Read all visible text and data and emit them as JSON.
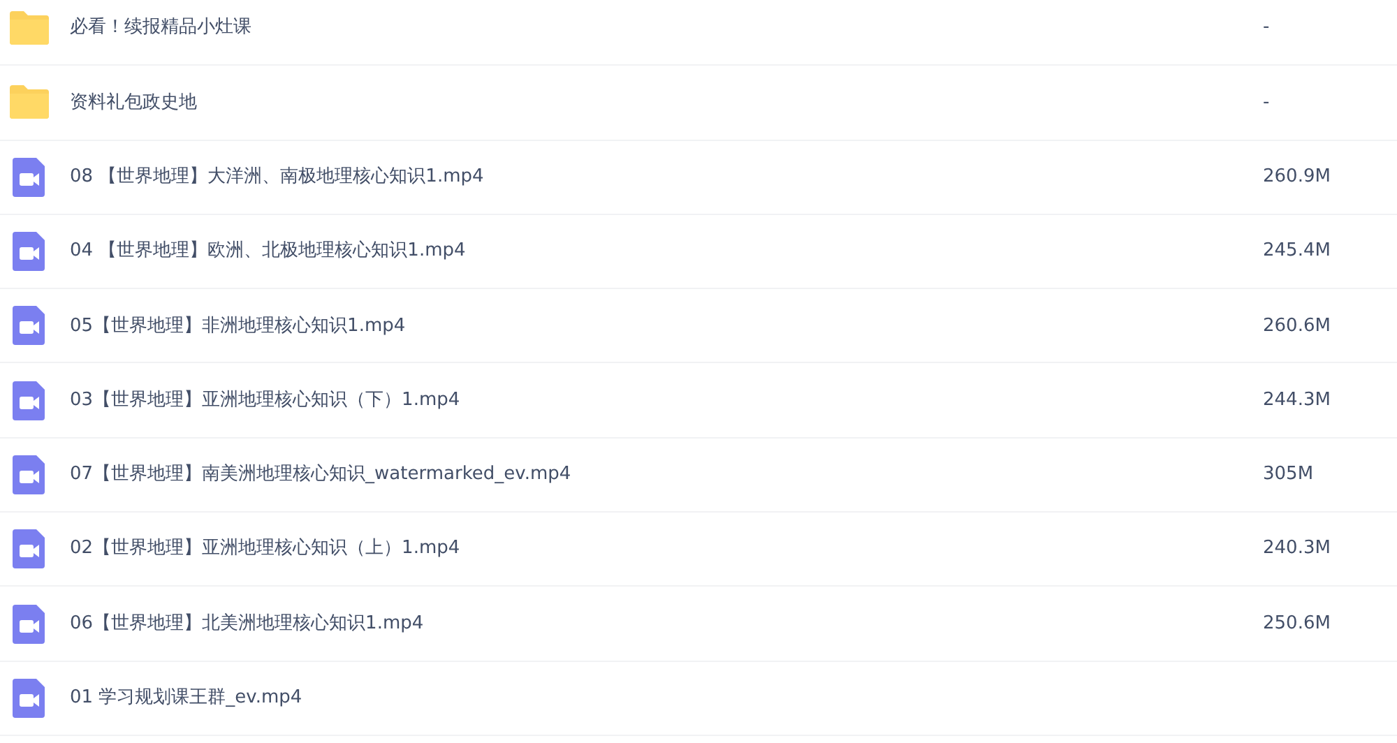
{
  "files": [
    {
      "kind": "folder",
      "name": "必看！续报精品小灶课",
      "size": "-"
    },
    {
      "kind": "folder",
      "name": "资料礼包政史地",
      "size": "-"
    },
    {
      "kind": "video",
      "name": "08 【世界地理】大洋洲、南极地理核心知识1.mp4",
      "size": "260.9M"
    },
    {
      "kind": "video",
      "name": "04 【世界地理】欧洲、北极地理核心知识1.mp4",
      "size": "245.4M"
    },
    {
      "kind": "video",
      "name": "05【世界地理】非洲地理核心知识1.mp4",
      "size": "260.6M"
    },
    {
      "kind": "video",
      "name": "03【世界地理】亚洲地理核心知识（下）1.mp4",
      "size": "244.3M"
    },
    {
      "kind": "video",
      "name": "07【世界地理】南美洲地理核心知识_watermarked_ev.mp4",
      "size": "305M"
    },
    {
      "kind": "video",
      "name": "02【世界地理】亚洲地理核心知识（上）1.mp4",
      "size": "240.3M"
    },
    {
      "kind": "video",
      "name": "06【世界地理】北美洲地理核心知识1.mp4",
      "size": "250.6M"
    },
    {
      "kind": "video",
      "name": "01 学习规划课王群_ev.mp4"
    }
  ]
}
